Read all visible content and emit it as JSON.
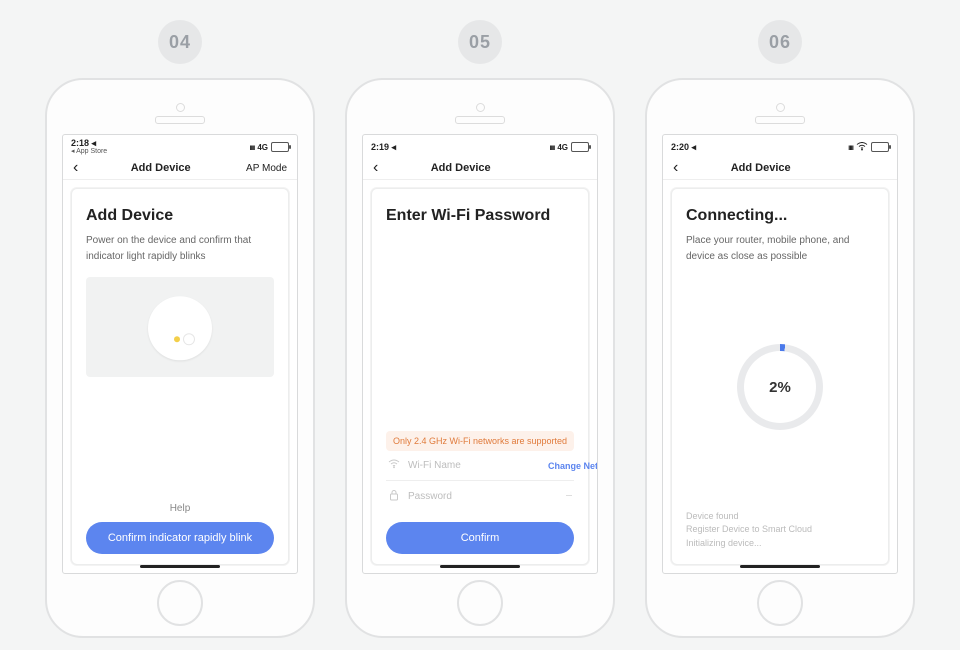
{
  "steps": {
    "s04": {
      "badge": "04"
    },
    "s05": {
      "badge": "05"
    },
    "s06": {
      "badge": "06"
    }
  },
  "statusbar": {
    "s04": {
      "time": "2:18",
      "loc_glyph": "◂",
      "back_label": "◂ App Store",
      "signal": "ıııı",
      "net": "4G",
      "battery_pct": 45
    },
    "s05": {
      "time": "2:19",
      "loc_glyph": "◂",
      "signal": "ıııı",
      "net": "4G",
      "battery_pct": 45
    },
    "s06": {
      "time": "2:20",
      "loc_glyph": "◂",
      "signal": "ıııı",
      "wifi_glyph": "◉",
      "battery_pct": 45
    }
  },
  "nav": {
    "back_glyph": "‹",
    "title": "Add Device",
    "ap_mode": "AP Mode"
  },
  "screen04": {
    "heading": "Add Device",
    "desc": "Power on the device and confirm that indicator light rapidly blinks",
    "help": "Help",
    "cta": "Confirm indicator rapidly blink"
  },
  "screen05": {
    "heading": "Enter Wi-Fi Password",
    "warning": "Only 2.4 GHz Wi-Fi networks are supported",
    "wifi_placeholder": "Wi-Fi Name",
    "change_network": "Change Network",
    "password_placeholder": "Password",
    "cta": "Confirm"
  },
  "screen06": {
    "heading": "Connecting...",
    "desc": "Place your router, mobile phone, and device as close as possible",
    "progress_label": "2%",
    "status1": "Device found",
    "status2": "Register Device to Smart Cloud",
    "status3": "Initializing device..."
  }
}
